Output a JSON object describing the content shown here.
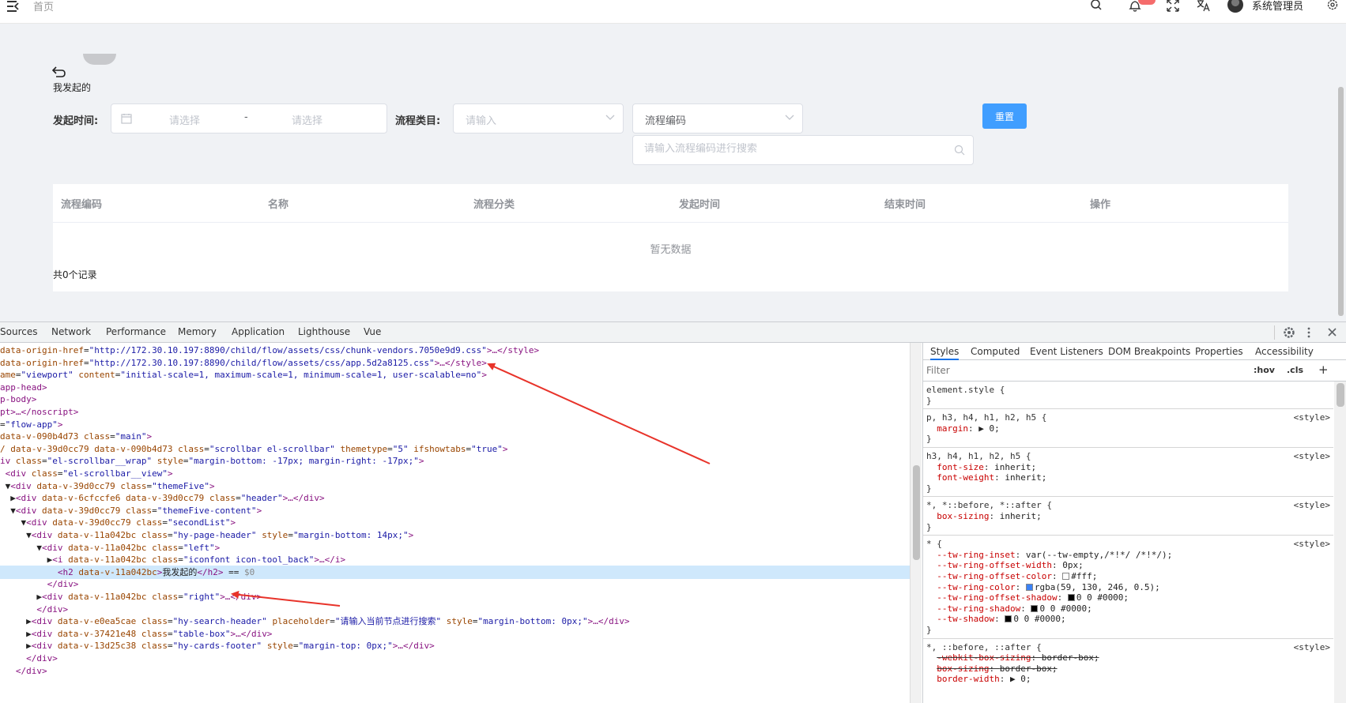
{
  "header": {
    "breadcrumb": "首页",
    "badge_count": "",
    "username": "系统管理员",
    "icons": [
      "menu-fold-icon",
      "search-icon",
      "bell-icon",
      "fullscreen-icon",
      "translate-icon",
      "gear-icon"
    ]
  },
  "page": {
    "title": "我发起的",
    "filters": {
      "start_time_label": "发起时间:",
      "start_placeholder": "请选择",
      "range_separator": "-",
      "end_placeholder": "请选择",
      "category_label": "流程类目:",
      "category_placeholder": "请输入",
      "code_select_value": "流程编码",
      "search_placeholder": "请输入流程编码进行搜索",
      "reset_label": "重置"
    },
    "table": {
      "columns": [
        "流程编码",
        "名称",
        "流程分类",
        "发起时间",
        "结束时间",
        "操作"
      ],
      "empty_text": "暂无数据"
    },
    "record_count": "共0个记录"
  },
  "devtools": {
    "tabs": [
      "Sources",
      "Network",
      "Performance",
      "Memory",
      "Application",
      "Lighthouse",
      "Vue"
    ],
    "elements_lines": [
      {
        "parts": [
          [
            "attr",
            "data-origin-href"
          ],
          [
            "txt",
            "="
          ],
          [
            "aval",
            "\"http://172.30.10.197:8890/child/flow/assets/css/chunk-vendors.7050e9d9.css\""
          ],
          [
            "tag",
            ">…</style>"
          ]
        ]
      },
      {
        "parts": [
          [
            "attr",
            "data-origin-href"
          ],
          [
            "txt",
            "="
          ],
          [
            "aval",
            "\"http://172.30.10.197:8890/child/flow/assets/css/app.5d2a8125.css\""
          ],
          [
            "tag",
            ">…</style>"
          ]
        ]
      },
      {
        "parts": [
          [
            "attr",
            "ame"
          ],
          [
            "txt",
            "="
          ],
          [
            "aval",
            "\"viewport\""
          ],
          [
            "txt",
            " "
          ],
          [
            "attr",
            "content"
          ],
          [
            "txt",
            "="
          ],
          [
            "aval",
            "\"initial-scale=1, maximum-scale=1, minimum-scale=1, user-scalable=no\""
          ],
          [
            "tag",
            ">"
          ]
        ]
      },
      {
        "parts": [
          [
            "tag",
            "app-head>"
          ]
        ]
      },
      {
        "parts": [
          [
            "tag",
            "p-body>"
          ]
        ]
      },
      {
        "parts": [
          [
            "tag",
            "pt>…</noscript>"
          ]
        ]
      },
      {
        "parts": [
          [
            "txt",
            "="
          ],
          [
            "aval",
            "\"flow-app\""
          ],
          [
            "tag",
            ">"
          ]
        ]
      },
      {
        "parts": [
          [
            "attr",
            "data-v-090b4d73"
          ],
          [
            "txt",
            " "
          ],
          [
            "attr",
            "class"
          ],
          [
            "txt",
            "="
          ],
          [
            "aval",
            "\"main\""
          ],
          [
            "tag",
            ">"
          ]
        ]
      },
      {
        "parts": [
          [
            "attr",
            "/ data-v-39d0cc79 data-v-090b4d73"
          ],
          [
            "txt",
            " "
          ],
          [
            "attr",
            "class"
          ],
          [
            "txt",
            "="
          ],
          [
            "aval",
            "\"scrollbar el-scrollbar\""
          ],
          [
            "txt",
            " "
          ],
          [
            "attr",
            "themetype"
          ],
          [
            "txt",
            "="
          ],
          [
            "aval",
            "\"5\""
          ],
          [
            "txt",
            " "
          ],
          [
            "attr",
            "ifshowtabs"
          ],
          [
            "txt",
            "="
          ],
          [
            "aval",
            "\"true\""
          ],
          [
            "tag",
            ">"
          ]
        ]
      },
      {
        "parts": [
          [
            "tag",
            "iv "
          ],
          [
            "attr",
            "class"
          ],
          [
            "txt",
            "="
          ],
          [
            "aval",
            "\"el-scrollbar__wrap\""
          ],
          [
            "txt",
            " "
          ],
          [
            "attr",
            "style"
          ],
          [
            "txt",
            "="
          ],
          [
            "aval",
            "\"margin-bottom: -17px; margin-right: -17px;\""
          ],
          [
            "tag",
            ">"
          ]
        ]
      },
      {
        "parts": [
          [
            "tag",
            " <div "
          ],
          [
            "attr",
            "class"
          ],
          [
            "txt",
            "="
          ],
          [
            "aval",
            "\"el-scrollbar__view\""
          ],
          [
            "tag",
            ">"
          ]
        ]
      },
      {
        "parts": [
          [
            "txt",
            " ▼"
          ],
          [
            "tag",
            "<div "
          ],
          [
            "attr",
            "data-v-39d0cc79"
          ],
          [
            "txt",
            " "
          ],
          [
            "attr",
            "class"
          ],
          [
            "txt",
            "="
          ],
          [
            "aval",
            "\"themeFive\""
          ],
          [
            "tag",
            ">"
          ]
        ]
      },
      {
        "parts": [
          [
            "txt",
            "  ▶"
          ],
          [
            "tag",
            "<div "
          ],
          [
            "attr",
            "data-v-6cfccfe6 data-v-39d0cc79"
          ],
          [
            "txt",
            " "
          ],
          [
            "attr",
            "class"
          ],
          [
            "txt",
            "="
          ],
          [
            "aval",
            "\"header\""
          ],
          [
            "tag",
            ">…</div>"
          ]
        ]
      },
      {
        "parts": [
          [
            "txt",
            "  ▼"
          ],
          [
            "tag",
            "<div "
          ],
          [
            "attr",
            "data-v-39d0cc79"
          ],
          [
            "txt",
            " "
          ],
          [
            "attr",
            "class"
          ],
          [
            "txt",
            "="
          ],
          [
            "aval",
            "\"themeFive-content\""
          ],
          [
            "tag",
            ">"
          ]
        ]
      },
      {
        "parts": [
          [
            "txt",
            "    ▼"
          ],
          [
            "tag",
            "<div "
          ],
          [
            "attr",
            "data-v-39d0cc79"
          ],
          [
            "txt",
            " "
          ],
          [
            "attr",
            "class"
          ],
          [
            "txt",
            "="
          ],
          [
            "aval",
            "\"secondList\""
          ],
          [
            "tag",
            ">"
          ]
        ]
      },
      {
        "parts": [
          [
            "txt",
            "     ▼"
          ],
          [
            "tag",
            "<div "
          ],
          [
            "attr",
            "data-v-11a042bc"
          ],
          [
            "txt",
            " "
          ],
          [
            "attr",
            "class"
          ],
          [
            "txt",
            "="
          ],
          [
            "aval",
            "\"hy-page-header\""
          ],
          [
            "txt",
            " "
          ],
          [
            "attr",
            "style"
          ],
          [
            "txt",
            "="
          ],
          [
            "aval",
            "\"margin-bottom: 14px;\""
          ],
          [
            "tag",
            ">"
          ]
        ]
      },
      {
        "parts": [
          [
            "txt",
            "       ▼"
          ],
          [
            "tag",
            "<div "
          ],
          [
            "attr",
            "data-v-11a042bc"
          ],
          [
            "txt",
            " "
          ],
          [
            "attr",
            "class"
          ],
          [
            "txt",
            "="
          ],
          [
            "aval",
            "\"left\""
          ],
          [
            "tag",
            ">"
          ]
        ]
      },
      {
        "parts": [
          [
            "txt",
            "         ▶"
          ],
          [
            "tag",
            "<i "
          ],
          [
            "attr",
            "data-v-11a042bc"
          ],
          [
            "txt",
            " "
          ],
          [
            "attr",
            "class"
          ],
          [
            "txt",
            "="
          ],
          [
            "aval",
            "\"iconfont icon-tool_back\""
          ],
          [
            "tag",
            ">…</i>"
          ]
        ]
      },
      {
        "parts": [
          [
            "txt",
            "           "
          ],
          [
            "tag",
            "<h2 "
          ],
          [
            "attr",
            "data-v-11a042bc"
          ],
          [
            "tag",
            ">"
          ],
          [
            "txt",
            "我发起的"
          ],
          [
            "tag",
            "</h2>"
          ],
          [
            "txt",
            " == "
          ],
          [
            "cm",
            "$0"
          ]
        ],
        "selected": true
      },
      {
        "parts": [
          [
            "txt",
            "         "
          ],
          [
            "tag",
            "</div>"
          ]
        ]
      },
      {
        "parts": [
          [
            "txt",
            "       ▶"
          ],
          [
            "tag",
            "<div "
          ],
          [
            "attr",
            "data-v-11a042bc"
          ],
          [
            "txt",
            " "
          ],
          [
            "attr",
            "class"
          ],
          [
            "txt",
            "="
          ],
          [
            "aval",
            "\"right\""
          ],
          [
            "tag",
            ">…</div>"
          ]
        ]
      },
      {
        "parts": [
          [
            "txt",
            "       "
          ],
          [
            "tag",
            "</div>"
          ]
        ]
      },
      {
        "parts": [
          [
            "txt",
            "     ▶"
          ],
          [
            "tag",
            "<div "
          ],
          [
            "attr",
            "data-v-e0ea5cae"
          ],
          [
            "txt",
            " "
          ],
          [
            "attr",
            "class"
          ],
          [
            "txt",
            "="
          ],
          [
            "aval",
            "\"hy-search-header\""
          ],
          [
            "txt",
            " "
          ],
          [
            "attr",
            "placeholder"
          ],
          [
            "txt",
            "="
          ],
          [
            "aval",
            "\"请输入当前节点进行搜索\""
          ],
          [
            "txt",
            " "
          ],
          [
            "attr",
            "style"
          ],
          [
            "txt",
            "="
          ],
          [
            "aval",
            "\"margin-bottom: 0px;\""
          ],
          [
            "tag",
            ">…</div>"
          ]
        ]
      },
      {
        "parts": [
          [
            "txt",
            "     ▶"
          ],
          [
            "tag",
            "<div "
          ],
          [
            "attr",
            "data-v-37421e48"
          ],
          [
            "txt",
            " "
          ],
          [
            "attr",
            "class"
          ],
          [
            "txt",
            "="
          ],
          [
            "aval",
            "\"table-box\""
          ],
          [
            "tag",
            ">…</div>"
          ]
        ]
      },
      {
        "parts": [
          [
            "txt",
            "     ▶"
          ],
          [
            "tag",
            "<div "
          ],
          [
            "attr",
            "data-v-13d25c38"
          ],
          [
            "txt",
            " "
          ],
          [
            "attr",
            "class"
          ],
          [
            "txt",
            "="
          ],
          [
            "aval",
            "\"hy-cards-footer\""
          ],
          [
            "txt",
            " "
          ],
          [
            "attr",
            "style"
          ],
          [
            "txt",
            "="
          ],
          [
            "aval",
            "\"margin-top: 0px;\""
          ],
          [
            "tag",
            ">…</div>"
          ]
        ]
      },
      {
        "parts": [
          [
            "txt",
            "     "
          ],
          [
            "tag",
            "</div>"
          ]
        ]
      },
      {
        "parts": [
          [
            "txt",
            "   "
          ],
          [
            "tag",
            "</div>"
          ]
        ]
      }
    ],
    "styles": {
      "tabs": [
        "Styles",
        "Computed",
        "Event Listeners",
        "DOM Breakpoints",
        "Properties",
        "Accessibility"
      ],
      "filter_placeholder": "Filter",
      "hov": ":hov",
      "cls": ".cls",
      "plus": "+",
      "lines": [
        {
          "text": "element.style {",
          "kind": "sel"
        },
        {
          "text": "}",
          "kind": "sel"
        },
        {
          "divider": true
        },
        {
          "text": "p, h3, h4, h1, h2, h5 {",
          "kind": "sel",
          "src": "<style>"
        },
        {
          "prop": "margin",
          "val": "▶ 0;"
        },
        {
          "text": "}",
          "kind": "sel"
        },
        {
          "divider": true
        },
        {
          "text": "h3, h4, h1, h2, h5 {",
          "kind": "sel",
          "src": "<style>"
        },
        {
          "prop": "font-size",
          "val": "inherit;"
        },
        {
          "prop": "font-weight",
          "val": "inherit;"
        },
        {
          "text": "}",
          "kind": "sel"
        },
        {
          "divider": true
        },
        {
          "text": "*, *::before, *::after {",
          "kind": "sel",
          "src": "<style>"
        },
        {
          "prop": "box-sizing",
          "val": "inherit;"
        },
        {
          "text": "}",
          "kind": "sel"
        },
        {
          "divider": true
        },
        {
          "text": "* {",
          "kind": "sel",
          "src": "<style>"
        },
        {
          "prop": "--tw-ring-inset",
          "val": "var(--tw-empty,/*!*/ /*!*/);"
        },
        {
          "prop": "--tw-ring-offset-width",
          "val": "0px;"
        },
        {
          "prop": "--tw-ring-offset-color",
          "val": "#fff;",
          "swatch": "#ffffff"
        },
        {
          "prop": "--tw-ring-color",
          "val": "rgba(59, 130, 246, 0.5);",
          "swatch": "#3b82f6"
        },
        {
          "prop": "--tw-ring-offset-shadow",
          "val": "0 0 #0000;",
          "swatch": "#000000"
        },
        {
          "prop": "--tw-ring-shadow",
          "val": "0 0 #0000;",
          "swatch": "#000000"
        },
        {
          "prop": "--tw-shadow",
          "val": "0 0 #0000;",
          "swatch": "#000000"
        },
        {
          "text": "}",
          "kind": "sel"
        },
        {
          "divider": true
        },
        {
          "text": "*, ::before, ::after {",
          "kind": "sel",
          "src": "<style>"
        },
        {
          "prop": "-webkit-box-sizing",
          "val": "border-box;",
          "strike": true
        },
        {
          "prop": "box-sizing",
          "val": "border-box;",
          "strike": true
        },
        {
          "prop": "border-width",
          "val": "▶ 0;"
        }
      ]
    }
  },
  "colors": {
    "primary": "#409eff",
    "badge": "#f56c6c",
    "annotation_arrow": "#e8332a"
  }
}
